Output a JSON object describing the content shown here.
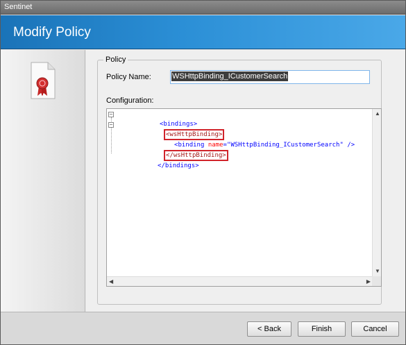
{
  "window": {
    "title": "Sentinet"
  },
  "header": {
    "title": "Modify Policy"
  },
  "policy": {
    "legend": "Policy",
    "name_label": "Policy Name:",
    "name_value": "WSHttpBinding_ICustomerSearch",
    "config_label": "Configuration:"
  },
  "config_lines": {
    "l1": "<bindings>",
    "l2": "<wsHttpBinding>",
    "l3_tag": "<binding",
    "l3_attr": "name",
    "l3_eq": "=",
    "l3_val": "\"WSHttpBinding_ICustomerSearch\"",
    "l3_end": " />",
    "l4": "</wsHttpBinding>",
    "l5": "</bindings>"
  },
  "footer": {
    "back_label": "< Back",
    "finish_label": "Finish",
    "cancel_label": "Cancel"
  },
  "colors": {
    "header_blue": "#2b8fd6",
    "highlight_red": "#d1232a",
    "xml_tag": "#a31515",
    "xml_attr": "#ff0000",
    "xml_value": "#0000ff"
  },
  "icons": {
    "policy_document": "policy-document-icon"
  }
}
